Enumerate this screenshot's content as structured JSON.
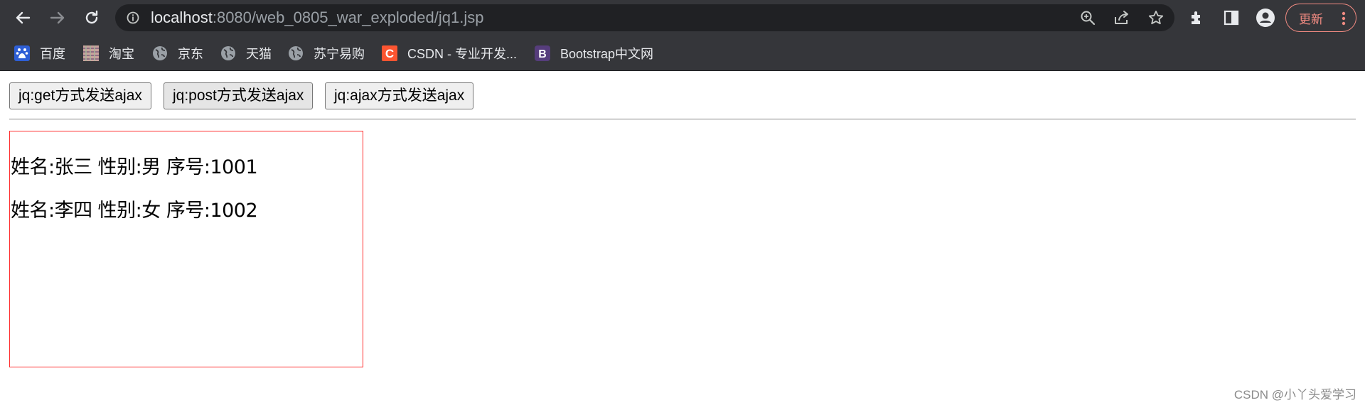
{
  "browser": {
    "url_host": "localhost",
    "url_rest": ":8080/web_0805_war_exploded/jq1.jsp",
    "update_label": "更新",
    "nav_icons": [
      "back-icon",
      "forward-icon",
      "reload-icon"
    ],
    "omnibox_icons": [
      "zoom-icon",
      "share-icon",
      "bookmark-star-icon"
    ],
    "toolbar_icons": [
      "extensions-icon",
      "side-panel-icon",
      "profile-icon"
    ]
  },
  "bookmarks": [
    {
      "label": "百度",
      "icon": "baidu-icon"
    },
    {
      "label": "淘宝",
      "icon": "taobao-icon"
    },
    {
      "label": "京东",
      "icon": "globe-icon"
    },
    {
      "label": "天猫",
      "icon": "globe-icon"
    },
    {
      "label": "苏宁易购",
      "icon": "globe-icon"
    },
    {
      "label": "CSDN - 专业开发...",
      "icon": "csdn-icon"
    },
    {
      "label": "Bootstrap中文网",
      "icon": "bootstrap-icon"
    }
  ],
  "buttons": {
    "get": "jq:get方式发送ajax",
    "post": "jq:post方式发送ajax",
    "ajax": "jq:ajax方式发送ajax"
  },
  "results": [
    "姓名:张三 性别:男 序号:1001",
    "姓名:李四 性别:女 序号:1002"
  ],
  "watermark": "CSDN @小丫头爱学习",
  "colors": {
    "chrome_bg": "#35363a",
    "omnibox_bg": "#202124",
    "update_accent": "#f28b82",
    "result_border": "#ff3030"
  }
}
